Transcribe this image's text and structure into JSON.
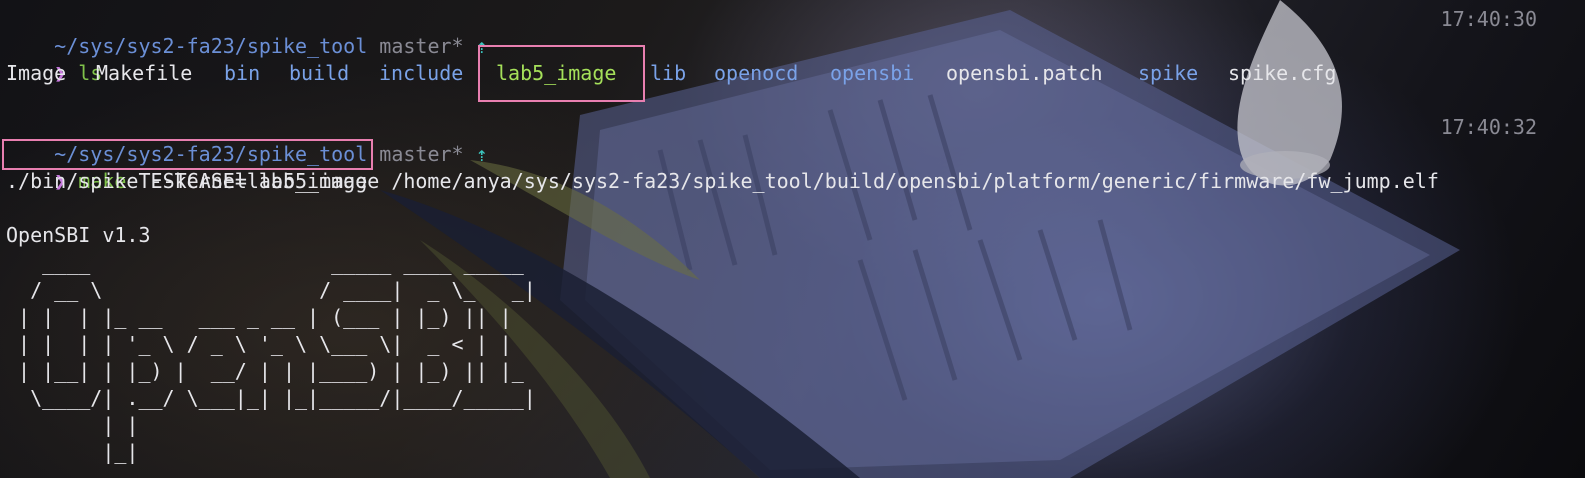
{
  "block1": {
    "path": "~/sys/sys2-fa23/spike_tool",
    "branch": "master*",
    "arrow": "⇡",
    "time": "17:40:30",
    "prompt_symbol": "❯",
    "command": "ls"
  },
  "ls_output": [
    {
      "name": "Image",
      "kind": "file"
    },
    {
      "name": "Makefile",
      "kind": "file"
    },
    {
      "name": "bin",
      "kind": "dir"
    },
    {
      "name": "build",
      "kind": "dir"
    },
    {
      "name": "include",
      "kind": "dir"
    },
    {
      "name": "lab5_image",
      "kind": "exec"
    },
    {
      "name": "lib",
      "kind": "dir"
    },
    {
      "name": "openocd",
      "kind": "dir"
    },
    {
      "name": "opensbi",
      "kind": "dir"
    },
    {
      "name": "opensbi.patch",
      "kind": "file"
    },
    {
      "name": "spike",
      "kind": "dir"
    },
    {
      "name": "spike.cfg",
      "kind": "file"
    }
  ],
  "block2": {
    "path": "~/sys/sys2-fa23/spike_tool",
    "branch": "master*",
    "arrow": "⇡",
    "time": "17:40:32",
    "prompt_symbol": "❯",
    "command": "make",
    "args": "TESTCASE=lab5_image"
  },
  "run_line": "./bin/spike --kernel lab5_image /home/anya/sys/sys2-fa23/spike_tool/build/opensbi/platform/generic/firmware/fw_jump.elf",
  "opensbi_version": "OpenSBI v1.3",
  "ascii_art": "   ____                    _____ ____ _____\n  / __ \\                  / ____|  _ \\_   _|\n | |  | |_ __   ___ _ __ | (___ | |_) || |\n | |  | | '_ \\ / _ \\ '_ \\ \\___ \\|  _ < | |\n | |__| | |_) |  __/ | | |____) | |_) || |_\n  \\____/| .__/ \\___|_| |_|_____/|____/_____|\n        | |\n        |_|",
  "colors": {
    "path": "#6b8fd6",
    "branch": "#8a8a94",
    "arrow": "#3cc7c0",
    "prompt": "#c678dd",
    "command": "#7fc24a",
    "dir": "#7aa2e8",
    "highlight_file": "#a5e05a",
    "highlight_box": "#e87fb0"
  }
}
